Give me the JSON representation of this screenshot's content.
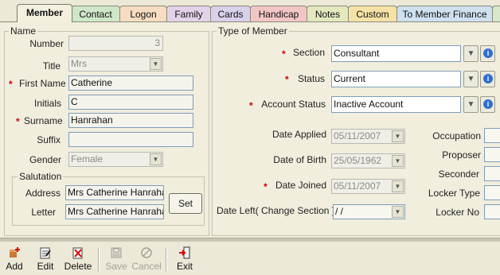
{
  "tabs": [
    {
      "label": "Member",
      "color": "#f4f0df",
      "active": true
    },
    {
      "label": "Contact",
      "color": "#cfe6c9"
    },
    {
      "label": "Logon",
      "color": "#f6dcc0"
    },
    {
      "label": "Family",
      "color": "#e3d3e8"
    },
    {
      "label": "Cards",
      "color": "#d9d0ea"
    },
    {
      "label": "Handicap",
      "color": "#f3c6c6"
    },
    {
      "label": "Notes",
      "color": "#e3e8bd"
    },
    {
      "label": "Custom",
      "color": "#f6e2a6"
    },
    {
      "label": "To Member Finance",
      "color": "#cfe0ef"
    },
    {
      "label": "",
      "color": "#d7e9c9"
    }
  ],
  "name_group": {
    "title": "Name",
    "number": {
      "label": "Number",
      "value": "3"
    },
    "title_field": {
      "label": "Title",
      "value": "Mrs"
    },
    "first_name": {
      "label": "First Name",
      "value": "Catherine",
      "required": "*"
    },
    "initials": {
      "label": "Initials",
      "value": "C"
    },
    "surname": {
      "label": "Surname",
      "value": "Hanrahan",
      "required": "*"
    },
    "suffix": {
      "label": "Suffix",
      "value": ""
    },
    "gender": {
      "label": "Gender",
      "value": "Female"
    },
    "salutation": {
      "title": "Salutation",
      "address": {
        "label": "Address",
        "value": "Mrs Catherine Hanrahan"
      },
      "letter": {
        "label": "Letter",
        "value": "Mrs Catherine Hanrahan"
      },
      "set_label": "Set"
    }
  },
  "type_group": {
    "title": "Type of Member",
    "section": {
      "label": "Section",
      "value": "Consultant",
      "required": "*"
    },
    "status": {
      "label": "Status",
      "value": "Current",
      "required": "*"
    },
    "account_status": {
      "label": "Account Status",
      "value": "Inactive Account",
      "required": "*"
    },
    "date_applied": {
      "label": "Date Applied",
      "value": "05/11/2007"
    },
    "date_of_birth": {
      "label": "Date of Birth",
      "value": "25/05/1962"
    },
    "date_joined": {
      "label": "Date Joined",
      "value": "05/11/2007",
      "required": "*"
    },
    "date_left": {
      "label": "Date Left( Change Section )",
      "value": " / /"
    },
    "occupation": {
      "label": "Occupation"
    },
    "proposer": {
      "label": "Proposer"
    },
    "seconder": {
      "label": "Seconder"
    },
    "locker_type": {
      "label": "Locker Type"
    },
    "locker_no": {
      "label": "Locker No"
    }
  },
  "toolbar": {
    "add": "Add",
    "edit": "Edit",
    "delete": "Delete",
    "save": "Save",
    "cancel": "Cancel",
    "exit": "Exit"
  },
  "icons": {
    "dropdown": "▼",
    "info": "i"
  }
}
